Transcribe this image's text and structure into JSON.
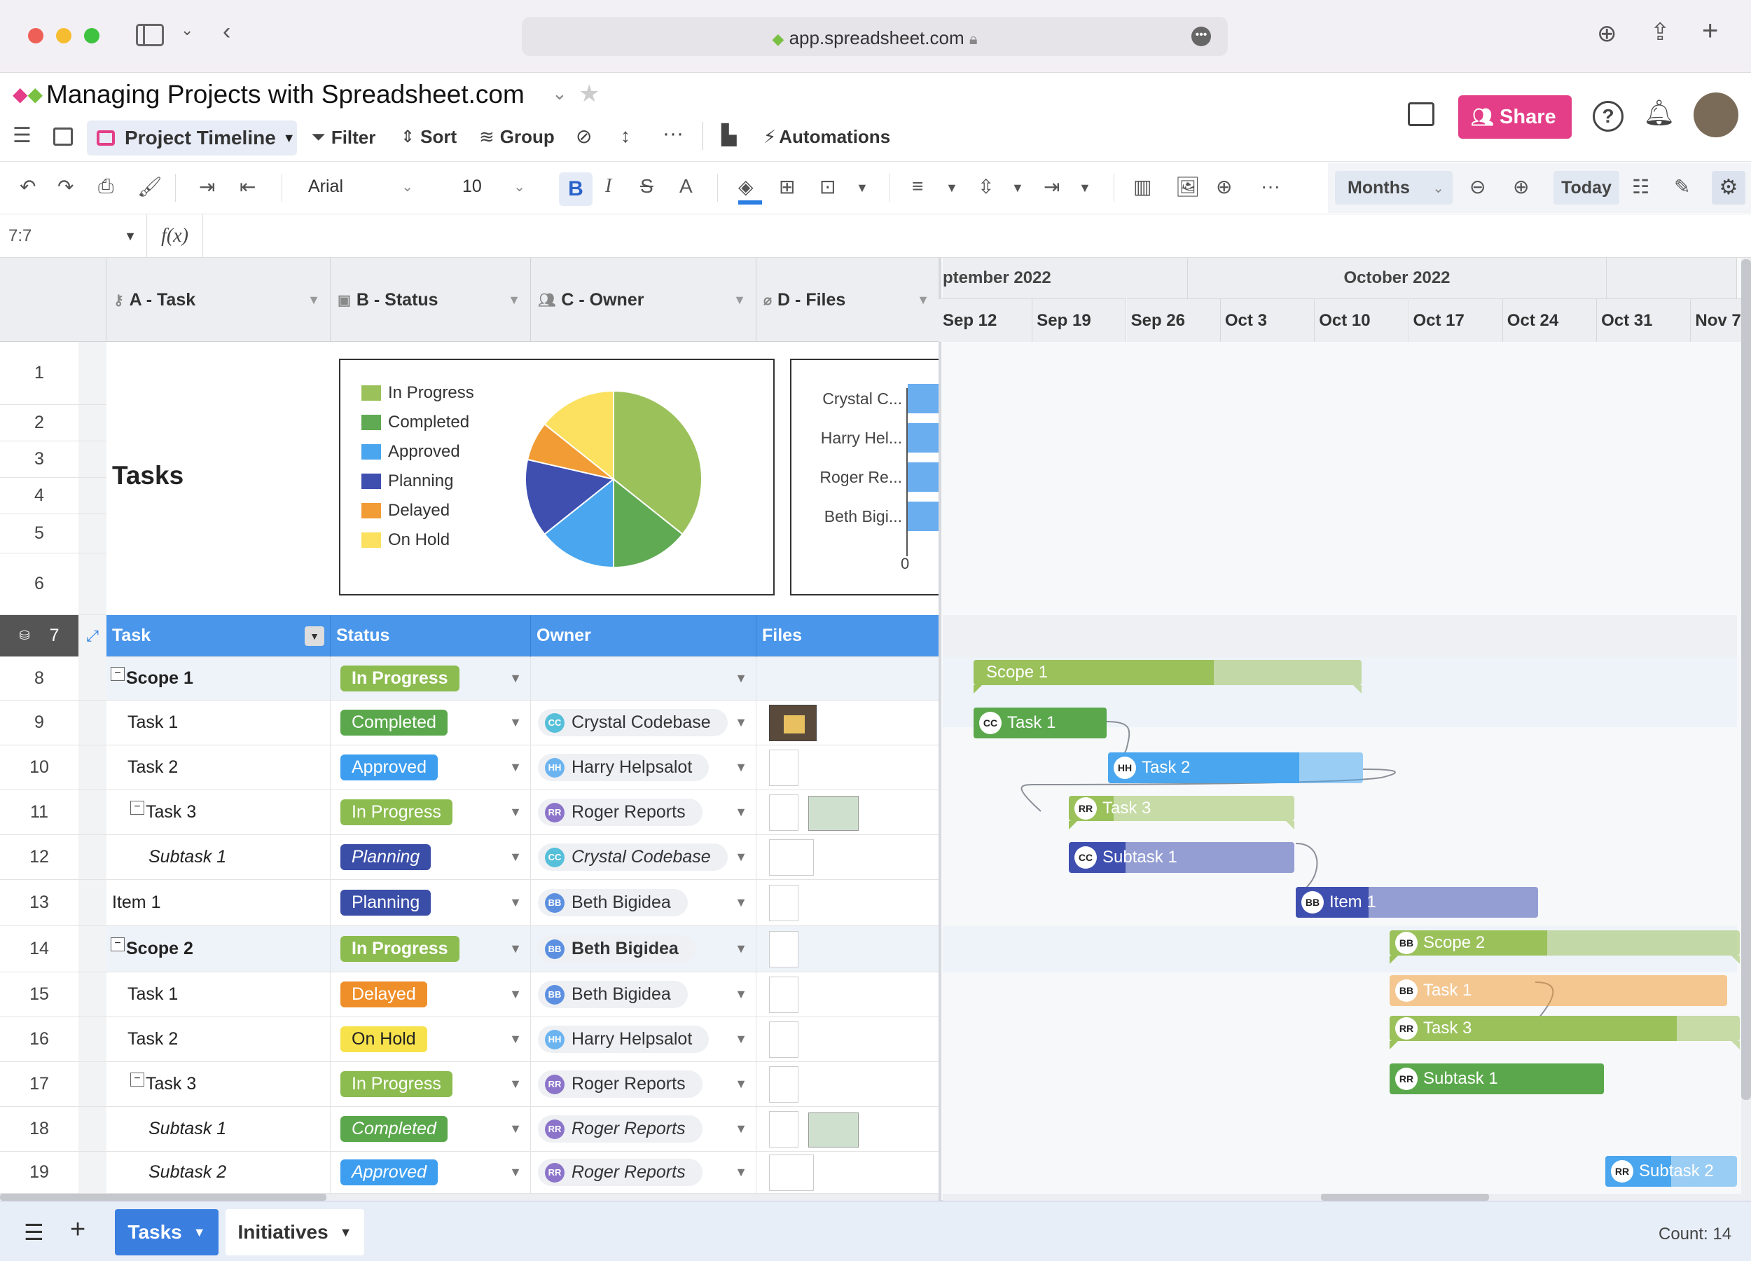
{
  "browser": {
    "url": "app.spreadsheet.com"
  },
  "app": {
    "title": "Managing Projects with Spreadsheet.com",
    "view_name": "Project Timeline",
    "toolbar": {
      "filter": "Filter",
      "sort": "Sort",
      "group": "Group",
      "automations": "Automations",
      "share": "Share"
    },
    "format": {
      "font": "Arial",
      "size": "10",
      "timescale": "Months",
      "today": "Today"
    },
    "cell_ref": "7:7",
    "fx": "f(x)"
  },
  "columns": [
    {
      "label": "A - Task",
      "icon": "key-icon"
    },
    {
      "label": "B - Status",
      "icon": "dropdown-field-icon"
    },
    {
      "label": "C - Owner",
      "icon": "people-icon"
    },
    {
      "label": "D - Files",
      "icon": "paperclip-icon"
    }
  ],
  "top_rows": [
    "1",
    "2",
    "3",
    "4",
    "5",
    "6"
  ],
  "tasks_heading": "Tasks",
  "pie_chart": {
    "chart_data": {
      "type": "pie",
      "categories": [
        "In Progress",
        "Completed",
        "Approved",
        "Planning",
        "Delayed",
        "On Hold"
      ],
      "values": [
        5,
        2,
        2,
        2,
        1,
        2
      ],
      "colors": [
        "#9bc15b",
        "#5faa52",
        "#4aa6ee",
        "#3e4fb0",
        "#f19c34",
        "#fbe15f"
      ]
    }
  },
  "bar_chart": {
    "chart_data": {
      "type": "bar",
      "orientation": "horizontal",
      "categories": [
        "Crystal C...",
        "Harry Hel...",
        "Roger Re...",
        "Beth Bigi..."
      ],
      "x_tick": "0",
      "color": "#6aaef0"
    }
  },
  "header_row": {
    "num": "7",
    "task": "Task",
    "status": "Status",
    "owner": "Owner",
    "files": "Files"
  },
  "rows": [
    {
      "num": "8",
      "task": "Scope 1",
      "indent": 0,
      "bold": true,
      "italic": false,
      "collapse": true,
      "status": "In Progress",
      "status_color": "#8cbc4f",
      "owner": "",
      "owner_init": "",
      "owner_color": "",
      "files": "none"
    },
    {
      "num": "9",
      "task": "Task 1",
      "indent": 1,
      "bold": false,
      "italic": false,
      "collapse": false,
      "status": "Completed",
      "status_color": "#5aa84b",
      "owner": "Crystal Codebase",
      "owner_init": "CC",
      "owner_color": "#56bfd9",
      "files": "photo"
    },
    {
      "num": "10",
      "task": "Task 2",
      "indent": 1,
      "bold": false,
      "italic": false,
      "collapse": false,
      "status": "Approved",
      "status_color": "#3d9ef0",
      "owner": "Harry Helpsalot",
      "owner_init": "HH",
      "owner_color": "#6cb4f0",
      "files": "doc"
    },
    {
      "num": "11",
      "task": "Task 3",
      "indent": 1,
      "bold": false,
      "italic": false,
      "collapse": true,
      "status": "In Progress",
      "status_color": "#8cbc4f",
      "owner": "Roger Reports",
      "owner_init": "RR",
      "owner_color": "#8b74c9",
      "files": "doc+cert"
    },
    {
      "num": "12",
      "task": "Subtask 1",
      "indent": 2,
      "bold": false,
      "italic": true,
      "collapse": false,
      "status": "Planning",
      "status_color": "#3a4ea8",
      "owner": "Crystal Codebase",
      "owner_init": "CC",
      "owner_color": "#56bfd9",
      "files": "wide"
    },
    {
      "num": "13",
      "task": "Item 1",
      "indent": 0,
      "bold": false,
      "italic": false,
      "collapse": false,
      "status": "Planning",
      "status_color": "#3a4ea8",
      "owner": "Beth Bigidea",
      "owner_init": "BB",
      "owner_color": "#5c8fe0",
      "files": "doc"
    },
    {
      "num": "14",
      "task": "Scope 2",
      "indent": 0,
      "bold": true,
      "italic": false,
      "collapse": true,
      "status": "In Progress",
      "status_color": "#8cbc4f",
      "owner": "Beth Bigidea",
      "owner_init": "BB",
      "owner_color": "#5c8fe0",
      "files": "doc"
    },
    {
      "num": "15",
      "task": "Task 1",
      "indent": 1,
      "bold": false,
      "italic": false,
      "collapse": false,
      "status": "Delayed",
      "status_color": "#ef8f2a",
      "owner": "Beth Bigidea",
      "owner_init": "BB",
      "owner_color": "#5c8fe0",
      "files": "doc"
    },
    {
      "num": "16",
      "task": "Task 2",
      "indent": 1,
      "bold": false,
      "italic": false,
      "collapse": false,
      "status": "On Hold",
      "status_color": "#f7e24b",
      "owner": "Harry Helpsalot",
      "owner_init": "HH",
      "owner_color": "#6cb4f0",
      "files": "doc"
    },
    {
      "num": "17",
      "task": "Task 3",
      "indent": 1,
      "bold": false,
      "italic": false,
      "collapse": true,
      "status": "In Progress",
      "status_color": "#8cbc4f",
      "owner": "Roger Reports",
      "owner_init": "RR",
      "owner_color": "#8b74c9",
      "files": "doc"
    },
    {
      "num": "18",
      "task": "Subtask 1",
      "indent": 2,
      "bold": false,
      "italic": true,
      "collapse": false,
      "status": "Completed",
      "status_color": "#5aa84b",
      "owner": "Roger Reports",
      "owner_init": "RR",
      "owner_color": "#8b74c9",
      "files": "doc+cert"
    },
    {
      "num": "19",
      "task": "Subtask 2",
      "indent": 2,
      "bold": false,
      "italic": true,
      "collapse": false,
      "status": "Approved",
      "status_color": "#3d9ef0",
      "owner": "Roger Reports",
      "owner_init": "RR",
      "owner_color": "#8b74c9",
      "files": "wide"
    }
  ],
  "gantt": {
    "months": [
      {
        "label": "ptember 2022"
      },
      {
        "label": "October 2022"
      }
    ],
    "weeks": [
      "Sep 12",
      "Sep 19",
      "Sep 26",
      "Oct 3",
      "Oct 10",
      "Oct 17",
      "Oct 24",
      "Oct 31",
      "Nov 7"
    ],
    "bars": [
      {
        "label": "Scope 1",
        "init": "",
        "color": "#9bc15b",
        "progress": 0.62,
        "bracket": true
      },
      {
        "label": "Task 1",
        "init": "CC",
        "color": "#5aa84b",
        "progress": 1.0,
        "bracket": false
      },
      {
        "label": "Task 2",
        "init": "HH",
        "color": "#4aa6ee",
        "progress": 0.75,
        "bracket": false
      },
      {
        "label": "Task 3",
        "init": "RR",
        "color": "#9bc15b",
        "progress": 0.2,
        "bracket": true
      },
      {
        "label": "Subtask 1",
        "init": "CC",
        "color": "#3e4fb0",
        "progress": 0.25,
        "bracket": false
      },
      {
        "label": "Item 1",
        "init": "BB",
        "color": "#3e4fb0",
        "progress": 0.3,
        "bracket": false
      },
      {
        "label": "Scope 2",
        "init": "BB",
        "color": "#9bc15b",
        "progress": 0.45,
        "bracket": true
      },
      {
        "label": "Task 1",
        "init": "BB",
        "color": "#f19c34",
        "progress": 0.0,
        "bracket": false
      },
      {
        "label": "Task 3",
        "init": "RR",
        "color": "#9bc15b",
        "progress": 0.82,
        "bracket": true
      },
      {
        "label": "Subtask 1",
        "init": "RR",
        "color": "#5aa84b",
        "progress": 1.0,
        "bracket": false
      },
      {
        "label": "Subtask 2",
        "init": "RR",
        "color": "#4aa6ee",
        "progress": 0.5,
        "bracket": false
      }
    ]
  },
  "sheets": {
    "active": "Tasks",
    "other": "Initiatives",
    "count": "Count: 14"
  }
}
